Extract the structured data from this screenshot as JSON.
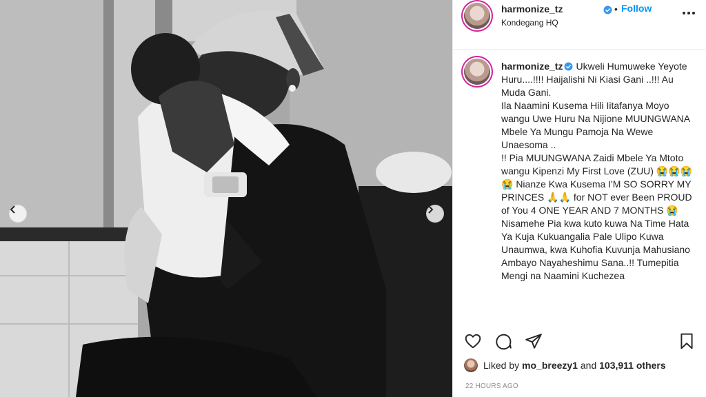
{
  "post": {
    "username": "harmonize_tz",
    "location": "Kondegang HQ",
    "follow_label": "Follow",
    "dot": "•",
    "caption_text": "Ukweli Humuweke Yeyote Huru....!!!! Haijalishi Ni Kiasi Gani ..!!! Au Muda Gani.\nIla Naamini Kusema Hili Iitafanya Moyo wangu Uwe Huru Na Nijione MUUNGWANA Mbele Ya Mungu Pamoja Na Wewe Unaesoma ..\n!! Pia MUUNGWANA Zaidi Mbele Ya Mtoto wangu Kipenzi My First Love (ZUU) 😭😭😭😭 Nianze Kwa Kusema I'M SO SORRY MY PRINCES 🙏🙏 for NOT ever Been PROUD of You 4 ONE YEAR AND 7 MONTHS 😭 Nisamehe Pia kwa kuto kuwa Na Time Hata Ya Kuja Kukuangalia Pale Ulipo Kuwa Unaumwa, kwa Kuhofia Kuvunja Mahusiano Ambayo Nayaheshimu Sana..!! Tumepitia Mengi na Naamini Kuchezea",
    "likes_prefix": "Liked by",
    "liked_by_user": "mo_breezy1",
    "likes_and": "and",
    "likes_count_text": "103,911 others",
    "timestamp": "22 HOURS AGO"
  },
  "icons": {
    "verified": "verified-badge-icon",
    "more": "more-options-icon",
    "like": "heart-icon",
    "comment": "comment-icon",
    "share": "share-icon",
    "save": "bookmark-icon",
    "prev": "chevron-left-icon",
    "next": "chevron-right-icon"
  },
  "colors": {
    "accent": "#0095f6",
    "verified": "#3897f0",
    "text": "#262626",
    "muted": "#8e8e8e"
  }
}
